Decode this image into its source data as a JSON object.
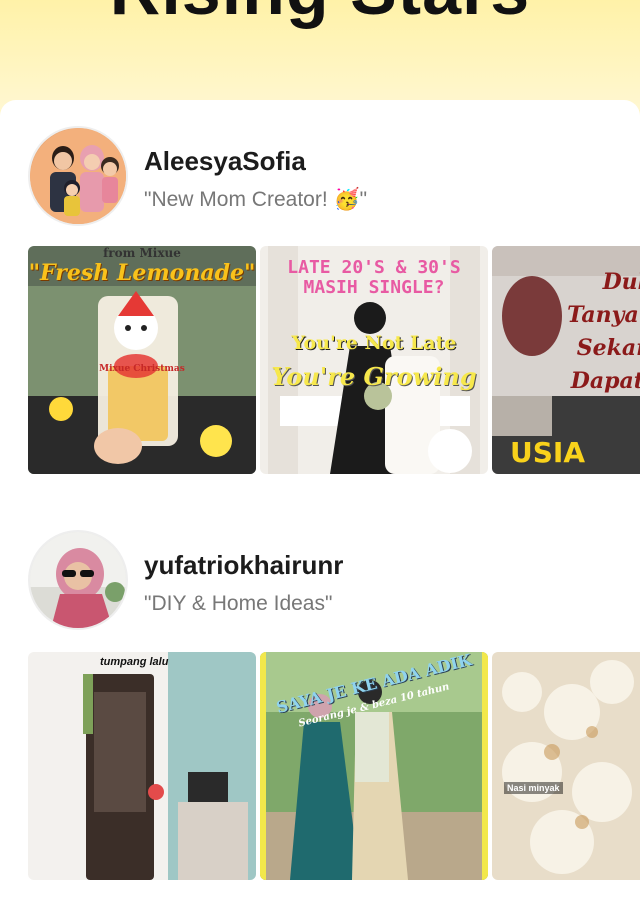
{
  "page": {
    "banner_title": "Rising Stars"
  },
  "creators": [
    {
      "username": "AleesyaSofia",
      "bio": "\"New Mom Creator! 🥳\"",
      "thumbnails": [
        {
          "top_text": "from Mixue",
          "headline": "\"Fresh Lemonade\"",
          "cup_label": "Mixue Christmas"
        },
        {
          "headline": "LATE 20'S & 30'S MASIH SINGLE?",
          "sub1": "You're Not Late",
          "sub2": "You're Growing"
        },
        {
          "lines": [
            "Dulu",
            "Tanya F",
            "Sekara",
            "Dapat J"
          ],
          "bottom": "USIA"
        }
      ]
    },
    {
      "username": "yufatriokhairunr",
      "bio": "\"DIY & Home Ideas\"",
      "thumbnails": [
        {
          "tag": "tumpang lalu"
        },
        {
          "headline": "SAYA JE KE ADA ADIK",
          "sub": "Seorang je & beza 10 tahun"
        },
        {
          "tag": "Nasi minyak"
        }
      ]
    }
  ]
}
